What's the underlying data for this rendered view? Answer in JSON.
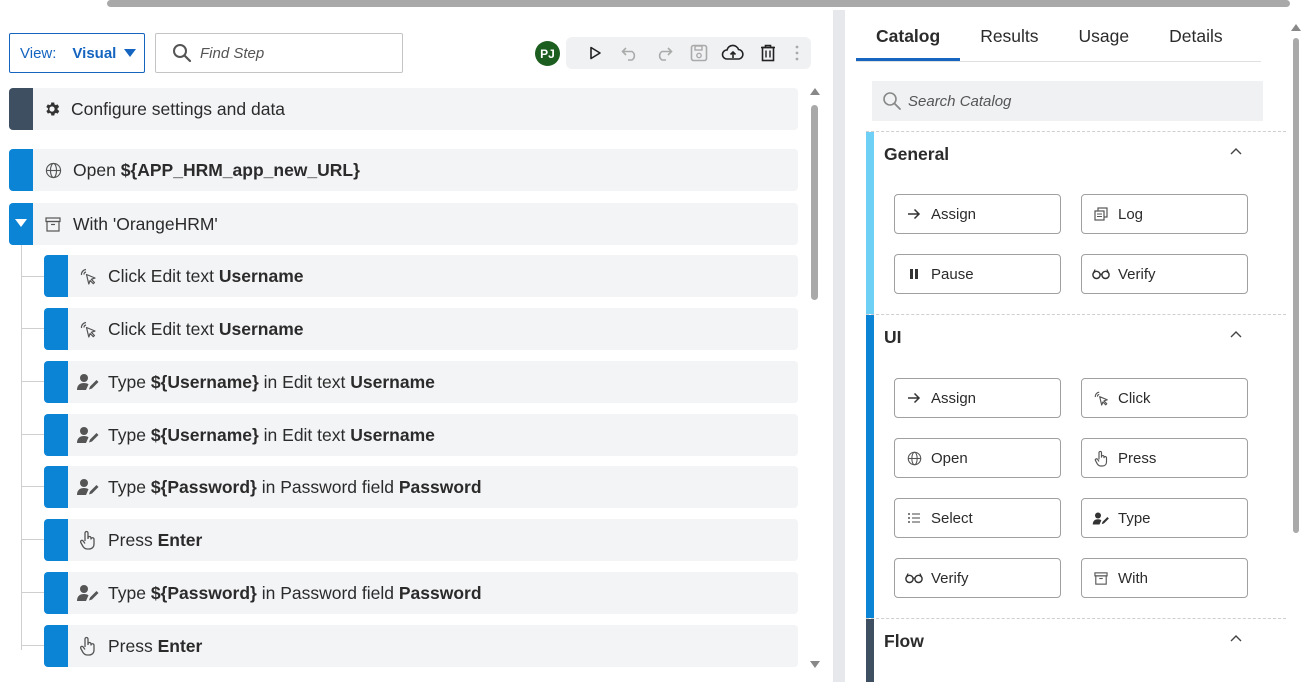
{
  "left": {
    "view_label": "View:",
    "view_value": "Visual",
    "find_placeholder": "Find Step",
    "avatar": "PJ",
    "steps": [
      {
        "parts": [
          "Configure settings and data"
        ],
        "bold": [
          false
        ]
      },
      {
        "parts": [
          "Open ",
          "${APP_HRM_app_new_URL}"
        ],
        "bold": [
          false,
          true
        ]
      },
      {
        "parts": [
          "With 'OrangeHRM'"
        ],
        "bold": [
          false
        ]
      },
      {
        "parts": [
          "Click Edit text ",
          "Username"
        ],
        "bold": [
          false,
          true
        ]
      },
      {
        "parts": [
          "Click Edit text ",
          "Username"
        ],
        "bold": [
          false,
          true
        ]
      },
      {
        "parts": [
          "Type ",
          "${Username}",
          " in Edit text ",
          "Username"
        ],
        "bold": [
          false,
          true,
          false,
          true
        ]
      },
      {
        "parts": [
          "Type ",
          "${Username}",
          " in Edit text ",
          "Username"
        ],
        "bold": [
          false,
          true,
          false,
          true
        ]
      },
      {
        "parts": [
          "Type ",
          "${Password}",
          " in Password field ",
          "Password"
        ],
        "bold": [
          false,
          true,
          false,
          true
        ]
      },
      {
        "parts": [
          "Press ",
          "Enter"
        ],
        "bold": [
          false,
          true
        ]
      },
      {
        "parts": [
          "Type ",
          "${Password}",
          " in Password field ",
          "Password"
        ],
        "bold": [
          false,
          true,
          false,
          true
        ]
      },
      {
        "parts": [
          "Press ",
          "Enter"
        ],
        "bold": [
          false,
          true
        ]
      }
    ]
  },
  "right": {
    "tabs": [
      "Catalog",
      "Results",
      "Usage",
      "Details"
    ],
    "active_tab": "Catalog",
    "search_placeholder": "Search Catalog",
    "sections": [
      {
        "title": "General",
        "color": "#6fd0f5",
        "items": [
          "Assign",
          "Log",
          "Pause",
          "Verify"
        ]
      },
      {
        "title": "UI",
        "color": "#0b84d6",
        "items": [
          "Assign",
          "Click",
          "Open",
          "Press",
          "Select",
          "Type",
          "Verify",
          "With"
        ]
      },
      {
        "title": "Flow",
        "color": "#3d4f61",
        "items": []
      }
    ]
  },
  "colors": {
    "accent": "#1565c0",
    "step_bar": "#0b84d6",
    "step_bar_dark": "#3d4f61",
    "avatar_bg": "#1b5e20"
  }
}
